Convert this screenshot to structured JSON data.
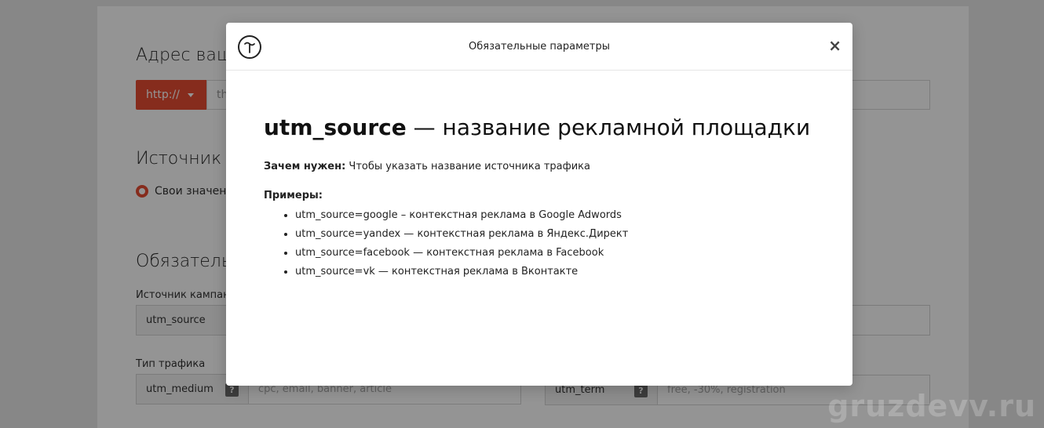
{
  "background": {
    "url_heading": "Адрес ваш",
    "protocol_label": "http://",
    "url_input_value": "th",
    "traffic_heading": "Источник тр",
    "radio_label": "Свои значени",
    "required_heading": "Обязательн",
    "campaign_source_label": "Источник кампан",
    "source_field_name": "utm_source",
    "traffic_type_label": "Тип трафика",
    "medium_field_name": "utm_medium",
    "medium_help": "?",
    "medium_placeholder": "cpc, email, banner, article",
    "term_field_name": "utm_term",
    "term_help": "?",
    "term_placeholder": "free, -30%, registration"
  },
  "watermark": "gruzdevv.ru",
  "modal": {
    "title": "Обязательные параметры",
    "close_label": "×",
    "heading_param": "utm_source",
    "heading_rest": " — название рекламной площадки",
    "why_label": "Зачем нужен:",
    "why_text": " Чтобы указать название источника трафика",
    "examples_title": "Примеры:",
    "examples": [
      "utm_source=google – контекстная реклама в Google Adwords",
      "utm_source=yandex — контекстная реклама в Яндекс.Директ",
      "utm_source=facebook — контекстная реклама в Facebook",
      "utm_source=vk — контекстная реклама в Вконтакте"
    ]
  }
}
